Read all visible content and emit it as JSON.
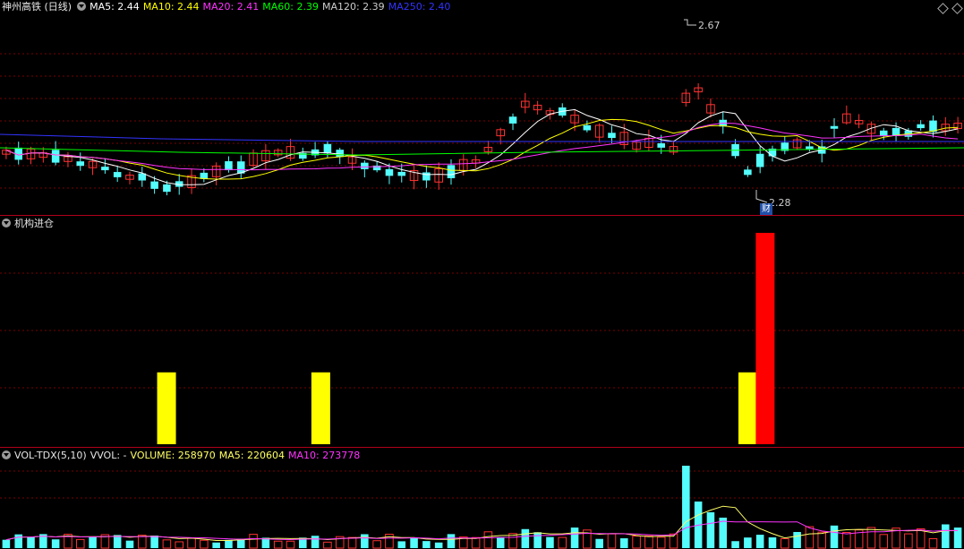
{
  "main": {
    "title": "神州高铁 (日线)",
    "indicators": [
      {
        "label": "MA5: 2.44",
        "color": "#ffffff"
      },
      {
        "label": "MA10: 2.44",
        "color": "#ffff00"
      },
      {
        "label": "MA20: 2.41",
        "color": "#ff33ff"
      },
      {
        "label": "MA60: 2.39",
        "color": "#00ff00"
      },
      {
        "label": "MA120: 2.39",
        "color": "#cccccc"
      },
      {
        "label": "MA250: 2.40",
        "color": "#3333ff"
      }
    ],
    "high_label": "2.67",
    "low_label": "2.28",
    "event_badge": "财",
    "colors": {
      "up": "#ff3232",
      "down": "#54fcfc",
      "grid": "#7a0000",
      "separator": "#b0001a"
    }
  },
  "ind": {
    "title": "机构进仓",
    "bars": [
      {
        "pos": 0.163,
        "value": 0.34,
        "color": "#ffff00"
      },
      {
        "pos": 0.323,
        "value": 0.34,
        "color": "#ffff00"
      },
      {
        "pos": 0.766,
        "value": 0.34,
        "color": "#ffff00"
      },
      {
        "pos": 0.784,
        "value": 1.0,
        "color": "#ff0000"
      }
    ]
  },
  "vol": {
    "title": "VOL-TDX(5,10)",
    "vvol": "VVOL: -",
    "volume": "VOLUME: 258970",
    "ma5": "MA5: 220604",
    "ma10": "MA10: 273778",
    "colors": {
      "volume": "#ffff66",
      "ma5": "#ffff66",
      "ma10": "#ff33ff"
    }
  }
}
